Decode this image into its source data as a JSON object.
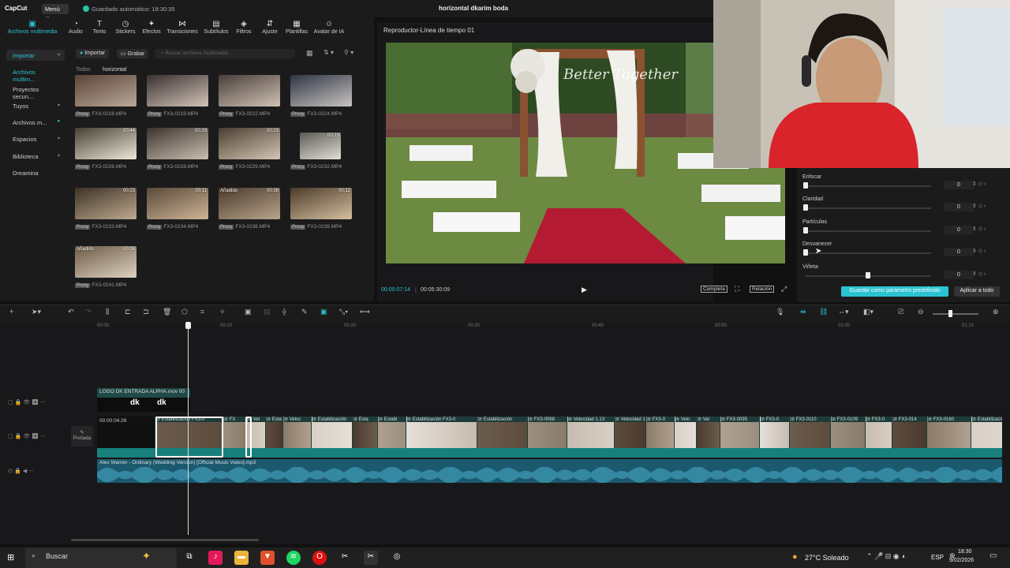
{
  "titlebar": {
    "app": "CapCut",
    "menu": "Menú ⌄",
    "autosave": "Guardado automático: 18:30:35",
    "project": "horizontal dkarim boda"
  },
  "toolbar": {
    "tools": [
      "Archivos multimedia",
      "Audio",
      "Texto",
      "Stickers",
      "Efectos",
      "Transiciones",
      "Subtítulos",
      "Filtros",
      "Ajuste",
      "Plantillas",
      "Avatar de IA"
    ]
  },
  "leftnav": {
    "items": [
      "Importar",
      "Archivos multim...",
      "Proyectos secun...",
      "Tuyos",
      "Archivos m...",
      "Espacios",
      "Biblioteca",
      "Dreamina"
    ]
  },
  "media": {
    "import_btn": "Importar",
    "record_btn": "Grabar",
    "search_placeholder": "Buscar archivos multimedia",
    "tab_all": "Todos",
    "tab_horizontal": "horizontal",
    "proxy": "Proxy",
    "added": "Añadido",
    "clips": [
      {
        "name": "FX3-0218.MP4",
        "dur": ""
      },
      {
        "name": "FX3-0219.MP4",
        "dur": ""
      },
      {
        "name": "FX3-0222.MP4",
        "dur": ""
      },
      {
        "name": "FX3-0224.MP4",
        "dur": ""
      },
      {
        "name": "FX3-0226.MP4",
        "dur": "00:44"
      },
      {
        "name": "FX3-0228.MP4",
        "dur": "00:29"
      },
      {
        "name": "FX3-0229.MP4",
        "dur": "00:23"
      },
      {
        "name": "FX3-0232.MP4",
        "dur": "00:19"
      },
      {
        "name": "FX3-0233.MP4",
        "dur": "00:23"
      },
      {
        "name": "FX3-0234.MP4",
        "dur": "00:11"
      },
      {
        "name": "FX3-0238.MP4",
        "dur": "00:38"
      },
      {
        "name": "FX3-0239.MP4",
        "dur": "00:12"
      },
      {
        "name": "FX3-0241.MP4",
        "dur": "00:08"
      }
    ]
  },
  "player": {
    "title": "Reproductor-Línea de tiempo 01",
    "current": "00:00:07:14",
    "total": "00:05:30:09",
    "btn_full": "Completa",
    "btn_ratio": "Relación",
    "watermark": "Better Together"
  },
  "adjust": {
    "sliders": [
      {
        "label": "Enfocar",
        "value": "0"
      },
      {
        "label": "Claridad",
        "value": "0"
      },
      {
        "label": "Partículas",
        "value": "0"
      },
      {
        "label": "Desvanecer",
        "value": "0"
      },
      {
        "label": "Viñeta",
        "value": "0"
      }
    ],
    "save_preset": "Guardar como parámetro predefinido",
    "apply_all": "Aplicar a todo"
  },
  "timeline": {
    "ticks": [
      "00:00",
      "00:10",
      "00:20",
      "00:30",
      "00:40",
      "00:50",
      "01:00",
      "01:10"
    ],
    "overlay_clip": "LOGO DK ENTRADA ALPHA.mov  00",
    "main_duration": "00:00:04:26",
    "cover": "Portada",
    "audio_clip": "Alex Warren - Ordinary (Wedding Version) [Official Music Video].mp3",
    "clip_labels": [
      "Estabilización FX3-0",
      "FX",
      "Vel",
      "Esta",
      "Veloc",
      "Estabilización",
      "Esta",
      "Estabi",
      "Estabilización FX3-0",
      "Estabilización",
      "FX3-0068",
      "Velocidad 1.1X",
      "Velocidad 1.1X",
      "FX3-0",
      "Velo",
      "Vel",
      "FX3-0095",
      "FX3-0",
      "FX3-0110",
      "FX3-0109",
      "FX3-0",
      "FX3-014",
      "FX3-0160"
    ]
  },
  "taskbar": {
    "search": "Buscar",
    "weather": "27°C Soleado",
    "lang": "ESP",
    "time": "18:30",
    "date": "9/02/2026"
  }
}
